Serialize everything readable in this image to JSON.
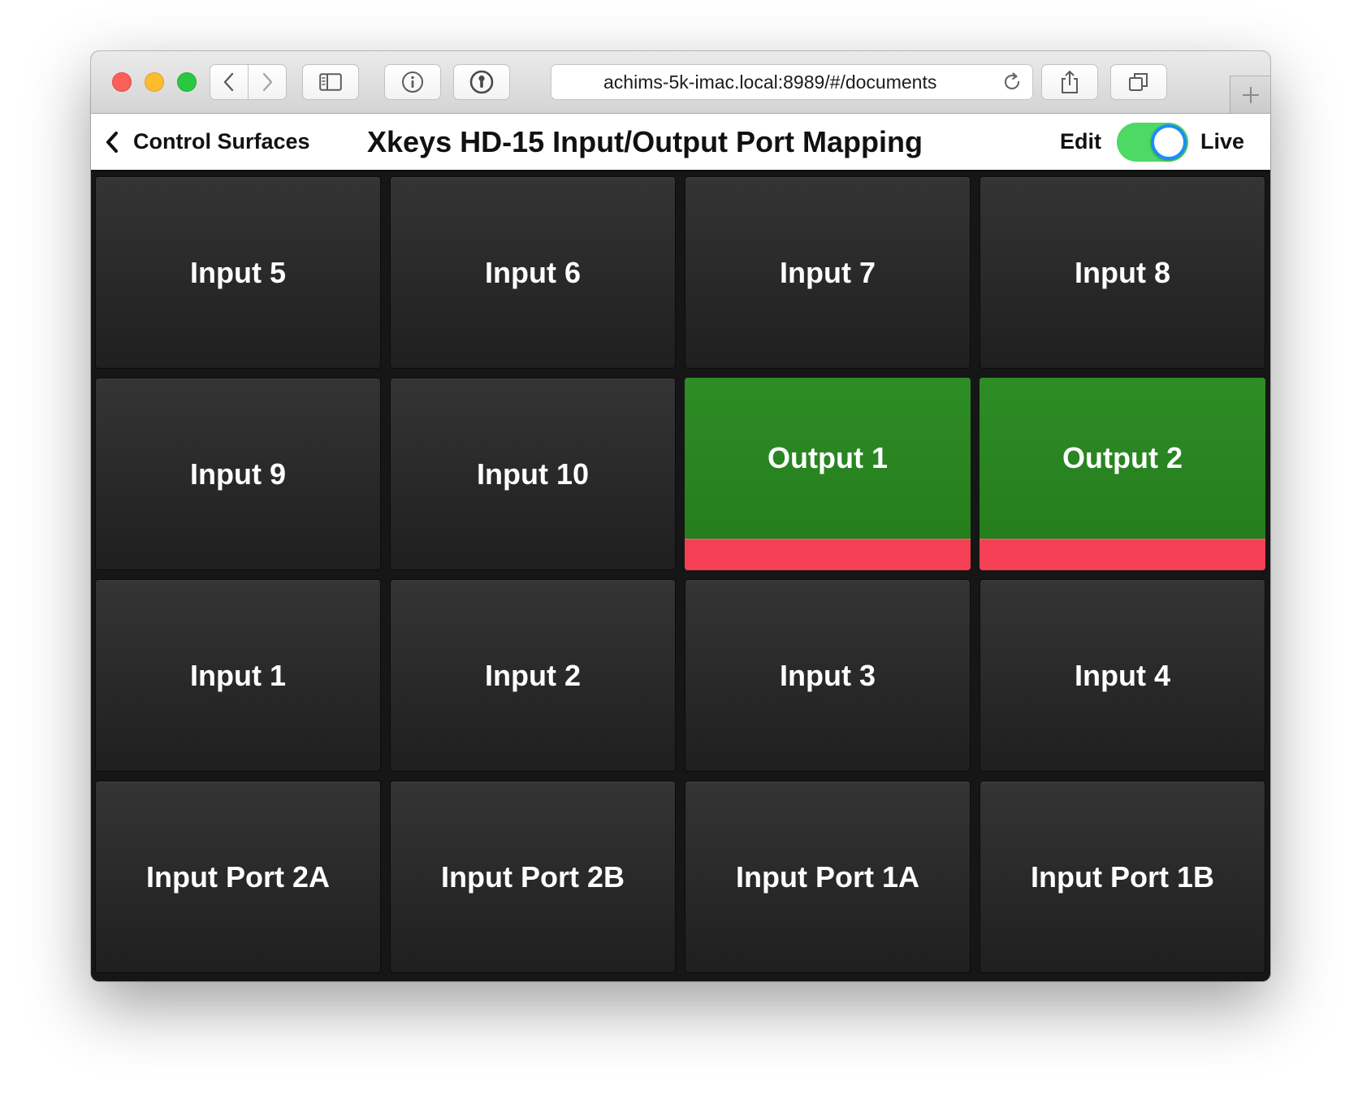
{
  "browser": {
    "url": "achims-5k-imac.local:8989/#/documents"
  },
  "header": {
    "back_label": "Control Surfaces",
    "title": "Xkeys HD-15 Input/Output Port Mapping",
    "mode_left": "Edit",
    "mode_right": "Live",
    "live_mode_on": true
  },
  "colors": {
    "active_key": "#2a8a24",
    "active_key_bar": "#f43f55",
    "toggle_on": "#4cd964",
    "toggle_ring": "#1a8cff"
  },
  "keys": [
    {
      "label": "Input 5",
      "active": false
    },
    {
      "label": "Input 6",
      "active": false
    },
    {
      "label": "Input 7",
      "active": false
    },
    {
      "label": "Input 8",
      "active": false
    },
    {
      "label": "Input 9",
      "active": false
    },
    {
      "label": "Input 10",
      "active": false
    },
    {
      "label": "Output 1",
      "active": true
    },
    {
      "label": "Output 2",
      "active": true
    },
    {
      "label": "Input 1",
      "active": false
    },
    {
      "label": "Input 2",
      "active": false
    },
    {
      "label": "Input 3",
      "active": false
    },
    {
      "label": "Input 4",
      "active": false
    },
    {
      "label": "Input Port 2A",
      "active": false
    },
    {
      "label": "Input Port 2B",
      "active": false
    },
    {
      "label": "Input Port 1A",
      "active": false
    },
    {
      "label": "Input Port 1B",
      "active": false
    }
  ]
}
